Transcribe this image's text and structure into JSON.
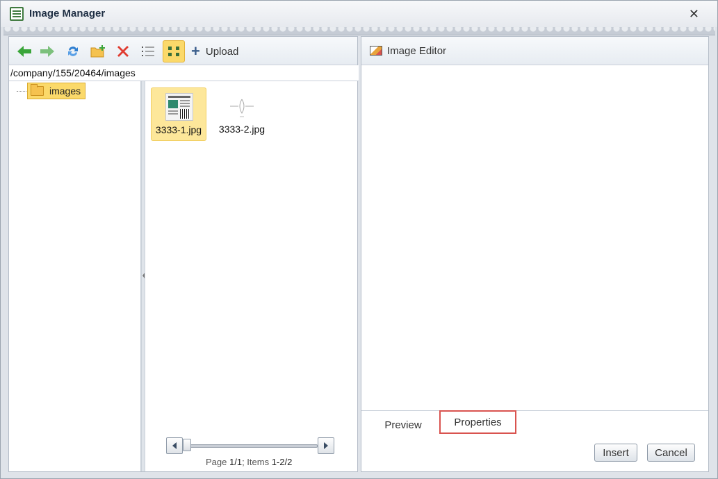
{
  "window": {
    "title": "Image Manager",
    "close_icon": "close-icon"
  },
  "toolbar": {
    "buttons": [
      {
        "name": "back",
        "icon": "arrow-left-icon",
        "color": "#3aa53a"
      },
      {
        "name": "forward",
        "icon": "arrow-right-icon",
        "color": "#7cc07c"
      },
      {
        "name": "refresh",
        "icon": "refresh-icon",
        "color": "#2f7fd1"
      },
      {
        "name": "new-folder",
        "icon": "new-folder-icon",
        "color": "#f0b43c"
      },
      {
        "name": "delete",
        "icon": "delete-icon",
        "color": "#e03c31"
      },
      {
        "name": "list-view",
        "icon": "list-view-icon",
        "color": "#555555"
      },
      {
        "name": "thumbnail-view",
        "icon": "thumbnail-view-icon",
        "color": "#3a6f3a",
        "active": true
      }
    ],
    "upload_label": "Upload"
  },
  "path": "/company/155/20464/images",
  "tree": {
    "root_label": "images"
  },
  "files": [
    {
      "name": "3333-1.jpg",
      "selected": true
    },
    {
      "name": "3333-2.jpg",
      "selected": false
    }
  ],
  "pager": {
    "prefix_page": "Page ",
    "page": "1/1",
    "sep": "; Items ",
    "items": "1-2/2"
  },
  "editor": {
    "title": "Image Editor"
  },
  "tabs": {
    "preview": "Preview",
    "properties": "Properties"
  },
  "actions": {
    "insert": "Insert",
    "cancel": "Cancel"
  },
  "colors": {
    "selection": "#fbd96a",
    "highlight_border": "#d9534f"
  }
}
